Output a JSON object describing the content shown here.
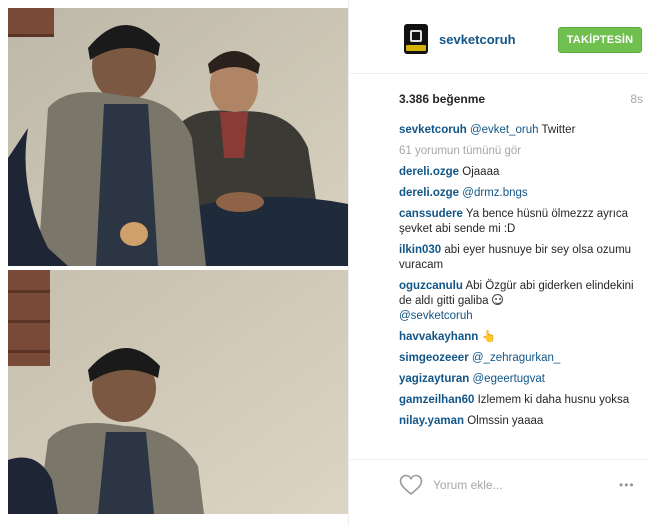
{
  "post": {
    "username": "sevketcoruh",
    "follow_label": "TAKİPTESİN",
    "likes": "3.386 beğenme",
    "time": "8s"
  },
  "caption": {
    "user": "sevketcoruh",
    "mention": "@evket_oruh",
    "text": " Twitter"
  },
  "view_all": "61 yorumun tümünü gör",
  "comments": [
    {
      "user": "dereli.ozge",
      "text": " Ojaaaa"
    },
    {
      "user": "dereli.ozge",
      "mention": " @drmz.bngs"
    },
    {
      "user": "canssudere",
      "text": " Ya bence hüsnü ölmezzz ayrıca şevket abi sende mi :D"
    },
    {
      "user": "ilkin030",
      "text": " abi eyer husnuye bir sey olsa ozumu vuracam"
    },
    {
      "user": "oguzcanulu",
      "text": " Abi Özgür abi giderken elindekini de aldı gitti galiba ",
      "mention2": "@sevketcoruh"
    },
    {
      "user": "havvakayhann",
      "text": " 👆"
    },
    {
      "user": "simgeozeeer",
      "mention": " @_zehragurkan_"
    },
    {
      "user": "yagizayturan",
      "mention": " @egeertugvat"
    },
    {
      "user": "gamzeilhan60",
      "text": " Izlemem ki daha husnu yoksa"
    },
    {
      "user": "nilay.yaman",
      "text": " Olmssin yaaaa"
    }
  ],
  "footer": {
    "placeholder": "Yorum ekle...",
    "more": "•••"
  },
  "icons": {
    "heart": "heart-icon",
    "more": "more-options-icon",
    "avatar": "profile-avatar"
  },
  "colors": {
    "username": "#125688",
    "follow_button": "#70c050",
    "muted": "#a5a7aa"
  }
}
